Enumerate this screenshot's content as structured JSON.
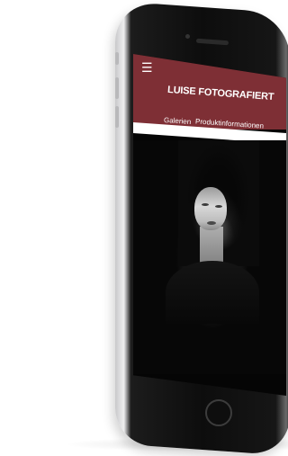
{
  "site": {
    "menu_icon": "hamburger-menu-icon",
    "title": "LUISE FOTOGRAFIERT",
    "nav": [
      {
        "label": "Galerien"
      },
      {
        "label": "Produktinformationen"
      }
    ]
  },
  "colors": {
    "header_bg": "#7e2f35",
    "header_text": "#ffffff",
    "screen_bg": "#050505"
  }
}
